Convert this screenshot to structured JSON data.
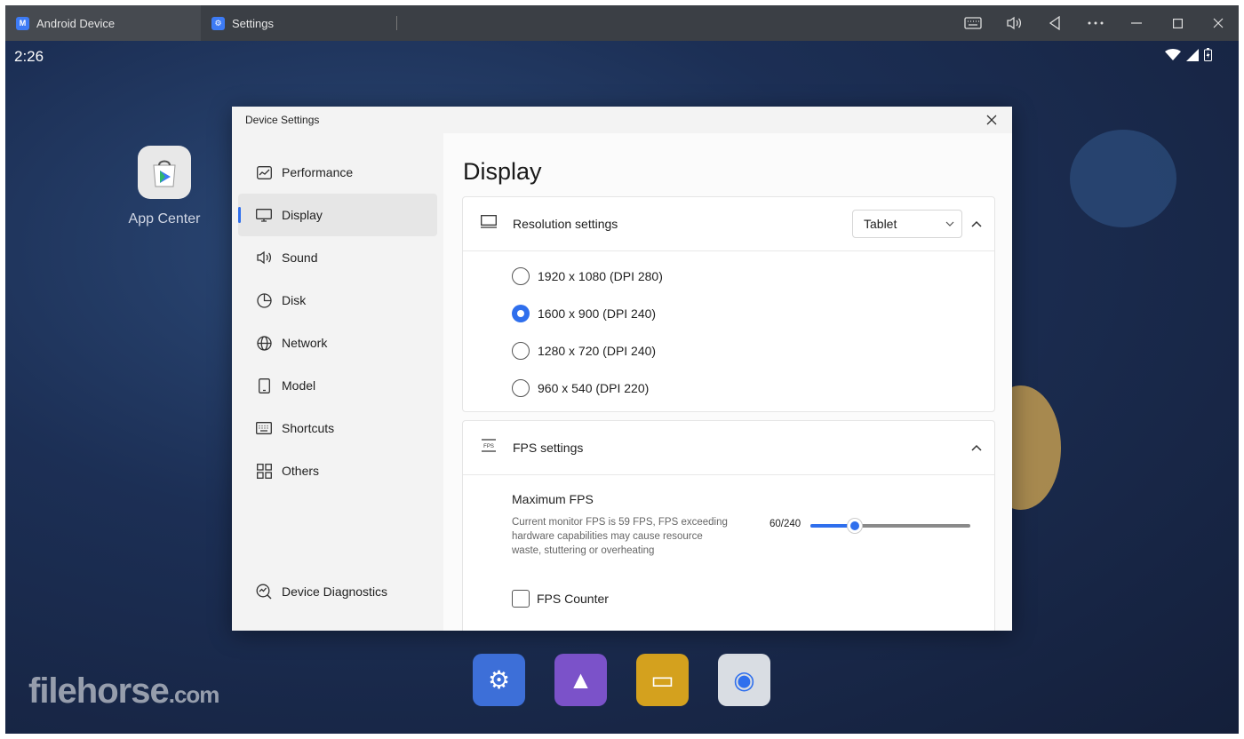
{
  "titlebar": {
    "tabs": [
      {
        "label": "Android Device",
        "icon": "app-logo-icon"
      },
      {
        "label": "Settings",
        "icon": "gear-icon"
      }
    ],
    "buttons": [
      "keyboard-icon",
      "volume-icon",
      "back-icon",
      "more-icon",
      "minimize-icon",
      "maximize-icon",
      "close-icon"
    ]
  },
  "android": {
    "time": "2:26",
    "app_center_label": "App Center",
    "dock": [
      "settings-app",
      "gallery-app",
      "files-app",
      "media-app"
    ]
  },
  "watermark": {
    "main": "filehorse",
    "suffix": ".com"
  },
  "dialog": {
    "title": "Device Settings",
    "sidebar": {
      "items": [
        {
          "label": "Performance",
          "icon": "chart-icon"
        },
        {
          "label": "Display",
          "icon": "monitor-icon",
          "active": true
        },
        {
          "label": "Sound",
          "icon": "speaker-icon"
        },
        {
          "label": "Disk",
          "icon": "pie-icon"
        },
        {
          "label": "Network",
          "icon": "globe-icon"
        },
        {
          "label": "Model",
          "icon": "tablet-icon"
        },
        {
          "label": "Shortcuts",
          "icon": "keyboard-icon"
        },
        {
          "label": "Others",
          "icon": "grid-icon"
        }
      ],
      "diagnostics": {
        "label": "Device Diagnostics",
        "icon": "diagnostics-icon"
      }
    },
    "content": {
      "title": "Display",
      "resolution": {
        "title": "Resolution settings",
        "mode_selected": "Tablet",
        "options": [
          {
            "label": "1920 x 1080 (DPI 280)",
            "checked": false
          },
          {
            "label": "1600 x 900 (DPI 240)",
            "checked": true
          },
          {
            "label": "1280 x 720 (DPI 240)",
            "checked": false
          },
          {
            "label": "960 x 540 (DPI 220)",
            "checked": false
          }
        ]
      },
      "fps": {
        "title": "FPS settings",
        "icon_text": "FPS",
        "max_label": "Maximum FPS",
        "description": "Current monitor FPS is 59 FPS, FPS exceeding hardware capabilities may cause resource waste, stuttering or overheating",
        "value_text": "60/240",
        "value": 60,
        "max": 240,
        "counter_label": "FPS Counter",
        "counter_checked": false
      }
    }
  },
  "colors": {
    "accent": "#2f6fed"
  }
}
